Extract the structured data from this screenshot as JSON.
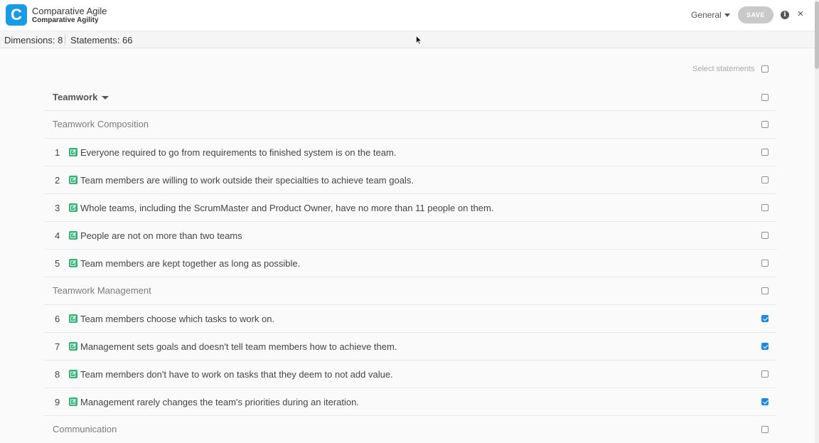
{
  "app": {
    "logo_letter": "C",
    "title": "Comparative Agile",
    "subtitle": "Comparative Agility"
  },
  "toolbar": {
    "dropdown_label": "General",
    "save_label": "SAVE",
    "info_icon": "info-icon",
    "close_icon": "close-icon",
    "close_glyph": "×",
    "info_glyph": "i"
  },
  "stats": {
    "dimensions": "Dimensions: 8",
    "statements": "Statements: 66"
  },
  "select_statements_label": "Select statements",
  "dimension": {
    "label": "Teamwork"
  },
  "sections": [
    {
      "label": "Teamwork Composition",
      "statements": [
        {
          "num": "1",
          "text": "Everyone required to go from requirements to finished system is on the team.",
          "checked": false
        },
        {
          "num": "2",
          "text": "Team members are willing to work outside their specialties to achieve team goals.",
          "checked": false
        },
        {
          "num": "3",
          "text": "Whole teams, including the ScrumMaster and Product Owner, have no more than 11 people on them.",
          "checked": false
        },
        {
          "num": "4",
          "text": "People are not on more than two teams",
          "checked": false
        },
        {
          "num": "5",
          "text": "Team members are kept together as long as possible.",
          "checked": false
        }
      ]
    },
    {
      "label": "Teamwork Management",
      "statements": [
        {
          "num": "6",
          "text": "Team members choose which tasks to work on.",
          "checked": true
        },
        {
          "num": "7",
          "text": "Management sets goals and doesn't tell team members how to achieve them.",
          "checked": true
        },
        {
          "num": "8",
          "text": "Team members don't have to work on tasks that they deem to not add value.",
          "checked": false
        },
        {
          "num": "9",
          "text": "Management rarely changes the team's priorities during an iteration.",
          "checked": true
        }
      ]
    },
    {
      "label": "Communication",
      "statements": []
    }
  ],
  "colors": {
    "brand": "#1a9be6",
    "checked": "#1e88e5",
    "edit_icon": "#2eb872",
    "save_disabled": "#c9c9c9"
  }
}
